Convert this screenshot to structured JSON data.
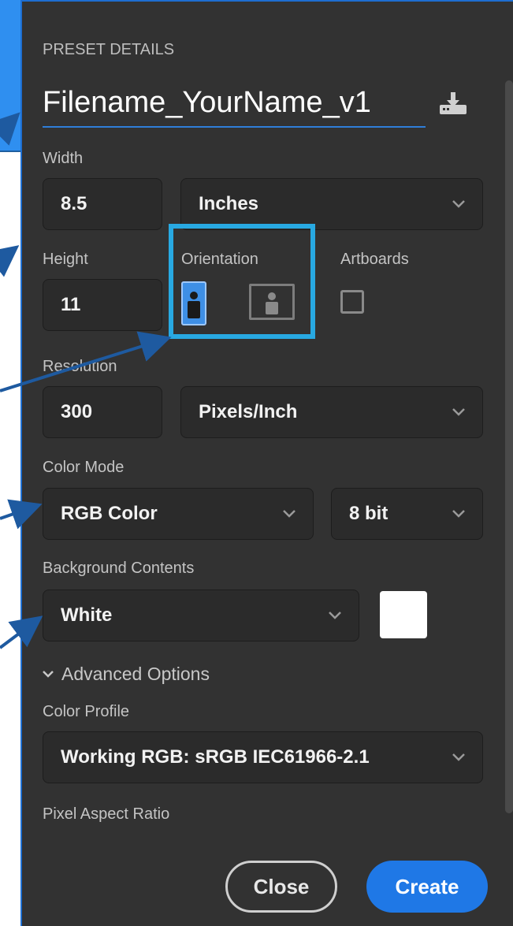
{
  "panel": {
    "section_title": "PRESET DETAILS",
    "filename": "Filename_YourName_v1"
  },
  "width": {
    "label": "Width",
    "value": "8.5",
    "unit": "Inches"
  },
  "height": {
    "label": "Height",
    "value": "11"
  },
  "orientation": {
    "label": "Orientation",
    "selected": "portrait"
  },
  "artboards": {
    "label": "Artboards",
    "checked": false
  },
  "resolution": {
    "label": "Resolution",
    "value": "300",
    "unit": "Pixels/Inch"
  },
  "color_mode": {
    "label": "Color Mode",
    "mode": "RGB Color",
    "depth": "8 bit"
  },
  "background": {
    "label": "Background Contents",
    "value": "White",
    "swatch_color": "#ffffff"
  },
  "advanced": {
    "label": "Advanced Options"
  },
  "color_profile": {
    "label": "Color Profile",
    "value": "Working RGB: sRGB IEC61966-2.1"
  },
  "pixel_aspect": {
    "label": "Pixel Aspect Ratio"
  },
  "buttons": {
    "close": "Close",
    "create": "Create"
  },
  "colors": {
    "panel_bg": "#323232",
    "accent": "#1f78e6",
    "highlight": "#28a9e2",
    "annotation_arrow": "#1e5aa0"
  },
  "icons": {
    "save_preset": "download-icon",
    "chevron": "chevron-down-icon",
    "portrait": "portrait-orientation-icon",
    "landscape": "landscape-orientation-icon"
  }
}
